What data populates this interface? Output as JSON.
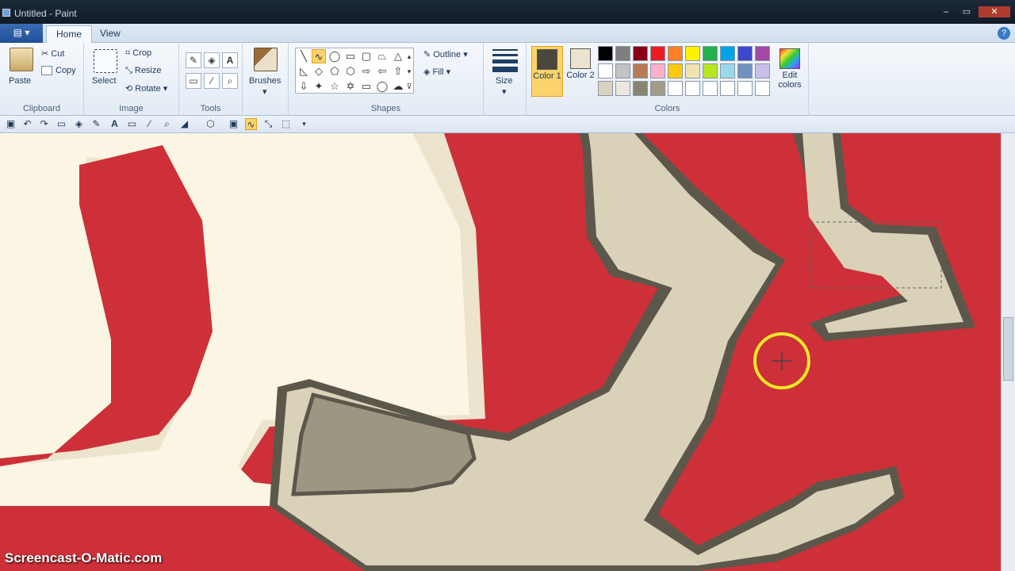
{
  "window": {
    "title": "Untitled - Paint",
    "minimize": "–",
    "maximize": "▭",
    "close": "✕"
  },
  "tabs": {
    "app_menu": "▤ ▾",
    "home": "Home",
    "view": "View",
    "help": "?"
  },
  "ribbon": {
    "clipboard": {
      "paste": "Paste",
      "cut": "Cut",
      "copy": "Copy",
      "label": "Clipboard"
    },
    "image": {
      "select": "Select",
      "crop": "Crop",
      "resize": "Resize",
      "rotate": "Rotate",
      "label": "Image"
    },
    "tools": {
      "label": "Tools"
    },
    "brushes": {
      "label": "Brushes"
    },
    "shapes": {
      "label": "Shapes",
      "outline": "Outline",
      "fill": "Fill"
    },
    "size": {
      "label": "Size"
    },
    "colors": {
      "color1": "Color 1",
      "color2": "Color 2",
      "edit_colors": "Edit colors",
      "label": "Colors",
      "color1_value": "#4a473d",
      "color2_value": "#ebe3cf",
      "palette_row1": [
        "#000000",
        "#7f7f7f",
        "#880015",
        "#ed1c24",
        "#ff7f27",
        "#fff200",
        "#22b14c",
        "#00a2e8",
        "#3f48cc",
        "#a349a4"
      ],
      "palette_row2": [
        "#ffffff",
        "#c3c3c3",
        "#b97a57",
        "#ffaec9",
        "#ffc90e",
        "#efe4b0",
        "#b5e61d",
        "#99d9ea",
        "#7092be",
        "#c8bfe7"
      ],
      "palette_row3": [
        "#d8d3c0",
        "#ece8dc",
        "#8a8572",
        "#a29c87",
        "#ffffff",
        "#ffffff",
        "#ffffff",
        "#ffffff",
        "#ffffff",
        "#ffffff"
      ]
    }
  },
  "canvas": {
    "background": "#cd3038",
    "cream": "#fbf6e4",
    "tan": "#d9d2b9",
    "outline": "#5c574b",
    "zoom_cursor": "#f0e82a"
  },
  "watermark": "Screencast-O-Matic.com"
}
